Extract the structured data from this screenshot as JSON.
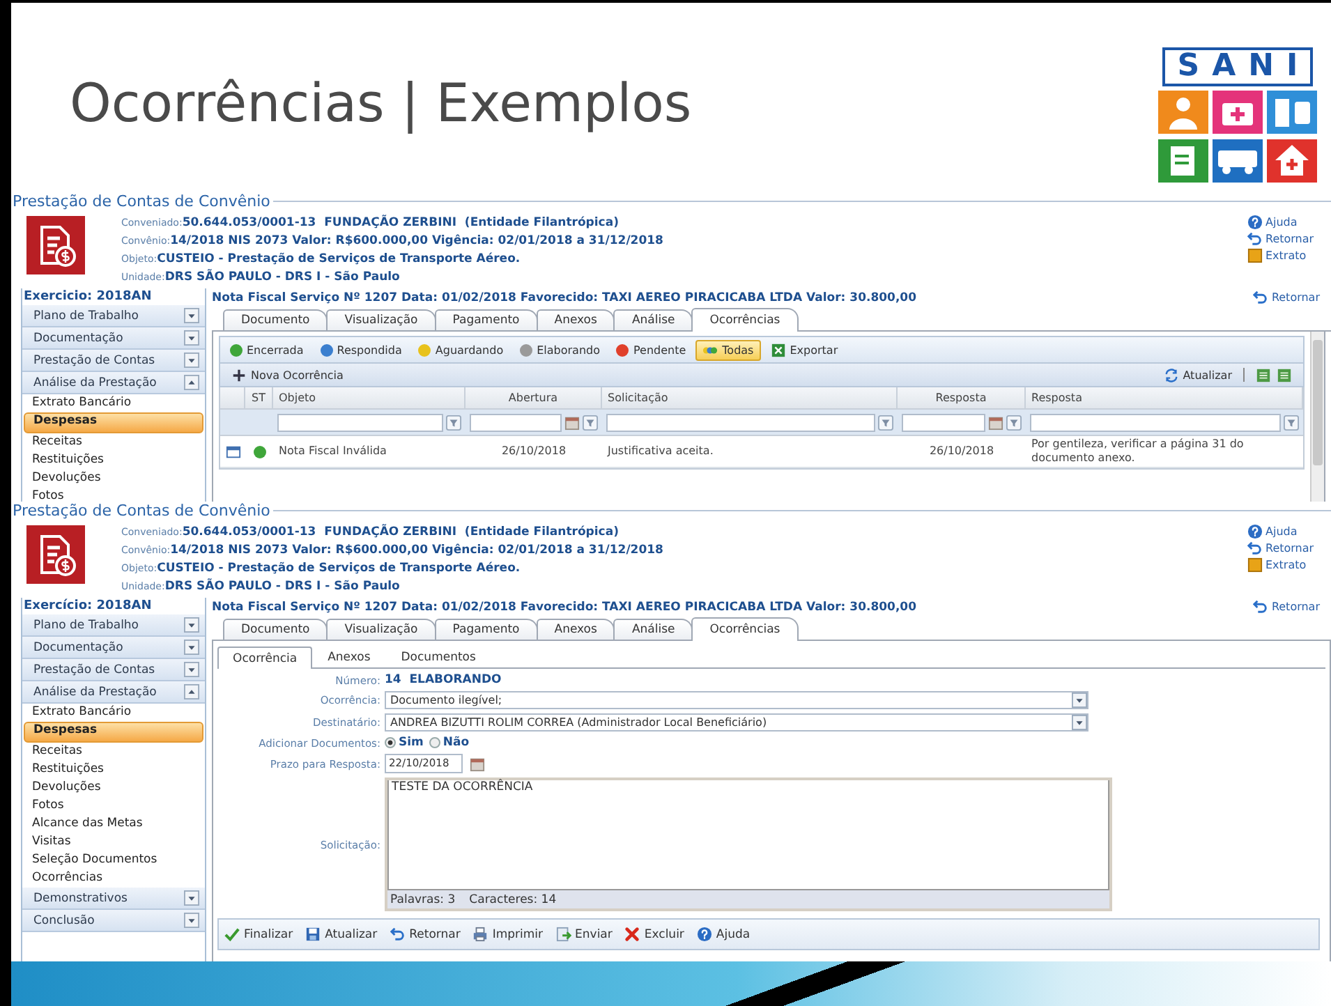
{
  "title": "Ocorrências | Exemplos",
  "logo": {
    "text": "SANI"
  },
  "panels": [
    {
      "kind": "list",
      "legend": "Prestação de Contas de Convênio",
      "fields": [
        {
          "label": "Conveniado:",
          "value": "50.644.053/0001-13  FUNDAÇÃO ZERBINI  (Entidade Filantrópica)"
        },
        {
          "label": "Convênio:",
          "value": "14/2018 NIS 2073 Valor: R$600.000,00 Vigência: 02/01/2018 a 31/12/2018"
        },
        {
          "label": "Objeto:",
          "value": "CUSTEIO - Prestação de Serviços de Transporte Aéreo."
        },
        {
          "label": "Unidade:",
          "value": "DRS SÃO PAULO - DRS I - São Paulo"
        }
      ],
      "links": [
        {
          "label": "Ajuda",
          "kind": "help"
        },
        {
          "label": "Retornar",
          "kind": "return"
        },
        {
          "label": "Extrato",
          "kind": "book"
        }
      ],
      "sidebar": {
        "exercise": "Exercicio: 2018AN",
        "items": [
          {
            "kind": "section",
            "label": "Plano de Trabalho",
            "expanded": false
          },
          {
            "kind": "section",
            "label": "Documentação",
            "expanded": false
          },
          {
            "kind": "section",
            "label": "Prestação de Contas",
            "expanded": false
          },
          {
            "kind": "section",
            "label": "Análise da Prestação",
            "expanded": true
          },
          {
            "kind": "link",
            "label": "Extrato Bancário",
            "selected": false
          },
          {
            "kind": "link",
            "label": "Despesas",
            "selected": true
          },
          {
            "kind": "link",
            "label": "Receitas",
            "selected": false
          },
          {
            "kind": "link",
            "label": "Restituições",
            "selected": false
          },
          {
            "kind": "link",
            "label": "Devoluções",
            "selected": false
          },
          {
            "kind": "link",
            "label": "Fotos",
            "selected": false
          }
        ]
      },
      "summary": "Nota Fiscal Serviço Nº 1207 Data: 01/02/2018 Favorecido: TAXI AEREO PIRACICABA LTDA Valor: 30.800,00",
      "return_label": "Retornar",
      "tabs": [
        {
          "label": "Documento",
          "selected": false
        },
        {
          "label": "Visualização",
          "selected": false
        },
        {
          "label": "Pagamento",
          "selected": false
        },
        {
          "label": "Anexos",
          "selected": false
        },
        {
          "label": "Análise",
          "selected": false
        },
        {
          "label": "Ocorrências",
          "selected": true
        }
      ],
      "filters": [
        {
          "kind": "status",
          "label": "Encerrada",
          "color": "#3fa63a",
          "selected": false
        },
        {
          "kind": "status",
          "label": "Respondida",
          "color": "#3b7fcf",
          "selected": false
        },
        {
          "kind": "status",
          "label": "Aguardando",
          "color": "#e8c21c",
          "selected": false
        },
        {
          "kind": "status",
          "label": "Elaborando",
          "color": "#9a9a9a",
          "selected": false
        },
        {
          "kind": "status",
          "label": "Pendente",
          "color": "#e0402b",
          "selected": false
        },
        {
          "kind": "all",
          "label": "Todas",
          "selected": true
        }
      ],
      "export_label": "Exportar",
      "new_label": "Nova Ocorrência",
      "refresh_label": "Atualizar",
      "status_label": "ST",
      "columns": [
        {
          "label": "Objeto",
          "kind": "text"
        },
        {
          "label": "Abertura",
          "kind": "date"
        },
        {
          "label": "Solicitação",
          "kind": "text"
        },
        {
          "label": "Resposta",
          "kind": "date"
        },
        {
          "label": "Resposta",
          "kind": "text"
        }
      ],
      "rows": [
        {
          "color": "#3fa63a",
          "cells": [
            "Nota Fiscal Inválida",
            "26/10/2018",
            "Justificativa aceita.",
            "26/10/2018",
            "Por gentileza, verificar a página 31 do documento anexo."
          ]
        }
      ]
    },
    {
      "kind": "form",
      "legend": "Prestação de Contas de Convênio",
      "fields": [
        {
          "label": "Conveniado:",
          "value": "50.644.053/0001-13  FUNDAÇÃO ZERBINI  (Entidade Filantrópica)"
        },
        {
          "label": "Convênio:",
          "value": "14/2018 NIS 2073 Valor: R$600.000,00 Vigência: 02/01/2018 a 31/12/2018"
        },
        {
          "label": "Objeto:",
          "value": "CUSTEIO - Prestação de Serviços de Transporte Aéreo."
        },
        {
          "label": "Unidade:",
          "value": "DRS SÃO PAULO - DRS I - São Paulo"
        }
      ],
      "links": [
        {
          "label": "Ajuda",
          "kind": "help"
        },
        {
          "label": "Retornar",
          "kind": "return"
        },
        {
          "label": "Extrato",
          "kind": "book"
        }
      ],
      "sidebar": {
        "exercise": "Exercício: 2018AN",
        "items": [
          {
            "kind": "section",
            "label": "Plano de Trabalho",
            "expanded": false
          },
          {
            "kind": "section",
            "label": "Documentação",
            "expanded": false
          },
          {
            "kind": "section",
            "label": "Prestação de Contas",
            "expanded": false
          },
          {
            "kind": "section",
            "label": "Análise da Prestação",
            "expanded": true
          },
          {
            "kind": "link",
            "label": "Extrato Bancário",
            "selected": false
          },
          {
            "kind": "link",
            "label": "Despesas",
            "selected": true
          },
          {
            "kind": "link",
            "label": "Receitas",
            "selected": false
          },
          {
            "kind": "link",
            "label": "Restituições",
            "selected": false
          },
          {
            "kind": "link",
            "label": "Devoluções",
            "selected": false
          },
          {
            "kind": "link",
            "label": "Fotos",
            "selected": false
          },
          {
            "kind": "link",
            "label": "Alcance das Metas",
            "selected": false
          },
          {
            "kind": "link",
            "label": "Visitas",
            "selected": false
          },
          {
            "kind": "link",
            "label": "Seleção Documentos",
            "selected": false
          },
          {
            "kind": "link",
            "label": "Ocorrências",
            "selected": false
          },
          {
            "kind": "section",
            "label": "Demonstrativos",
            "expanded": false
          },
          {
            "kind": "section",
            "label": "Conclusão",
            "expanded": false
          }
        ]
      },
      "summary": "Nota Fiscal Serviço Nº 1207 Data: 01/02/2018 Favorecido: TAXI AEREO PIRACICABA LTDA Valor: 30.800,00",
      "return_label": "Retornar",
      "tabs": [
        {
          "label": "Documento",
          "selected": false
        },
        {
          "label": "Visualização",
          "selected": false
        },
        {
          "label": "Pagamento",
          "selected": false
        },
        {
          "label": "Anexos",
          "selected": false
        },
        {
          "label": "Análise",
          "selected": false
        },
        {
          "label": "Ocorrências",
          "selected": true
        }
      ],
      "subtabs": [
        {
          "label": "Ocorrência",
          "selected": true
        },
        {
          "label": "Anexos",
          "selected": false
        },
        {
          "label": "Documentos",
          "selected": false
        }
      ],
      "form": [
        {
          "kind": "static",
          "label": "Número:",
          "value": "14  ELABORANDO"
        },
        {
          "kind": "select",
          "label": "Ocorrência:",
          "value": "Documento ilegível;"
        },
        {
          "kind": "select",
          "label": "Destinatário:",
          "value": "ANDREA BIZUTTI ROLIM CORREA (Administrador Local Beneficiário)"
        },
        {
          "kind": "radio",
          "label": "Adicionar Documentos:",
          "options": [
            {
              "label": "Sim",
              "selected": true
            },
            {
              "label": "Não",
              "selected": false
            }
          ]
        },
        {
          "kind": "date",
          "label": "Prazo para Resposta:",
          "value": "22/10/2018"
        },
        {
          "kind": "textarea",
          "label": "Solicitação:",
          "value": "TESTE DA OCORRÊNCIA",
          "counts": [
            "Palavras: 3",
            "Caracteres: 14"
          ]
        }
      ],
      "actions": [
        {
          "label": "Finalizar",
          "kind": "check"
        },
        {
          "label": "Atualizar",
          "kind": "save"
        },
        {
          "label": "Retornar",
          "kind": "return"
        },
        {
          "label": "Imprimir",
          "kind": "print"
        },
        {
          "label": "Enviar",
          "kind": "send"
        },
        {
          "label": "Excluir",
          "kind": "delete"
        },
        {
          "label": "Ajuda",
          "kind": "help"
        }
      ]
    }
  ]
}
